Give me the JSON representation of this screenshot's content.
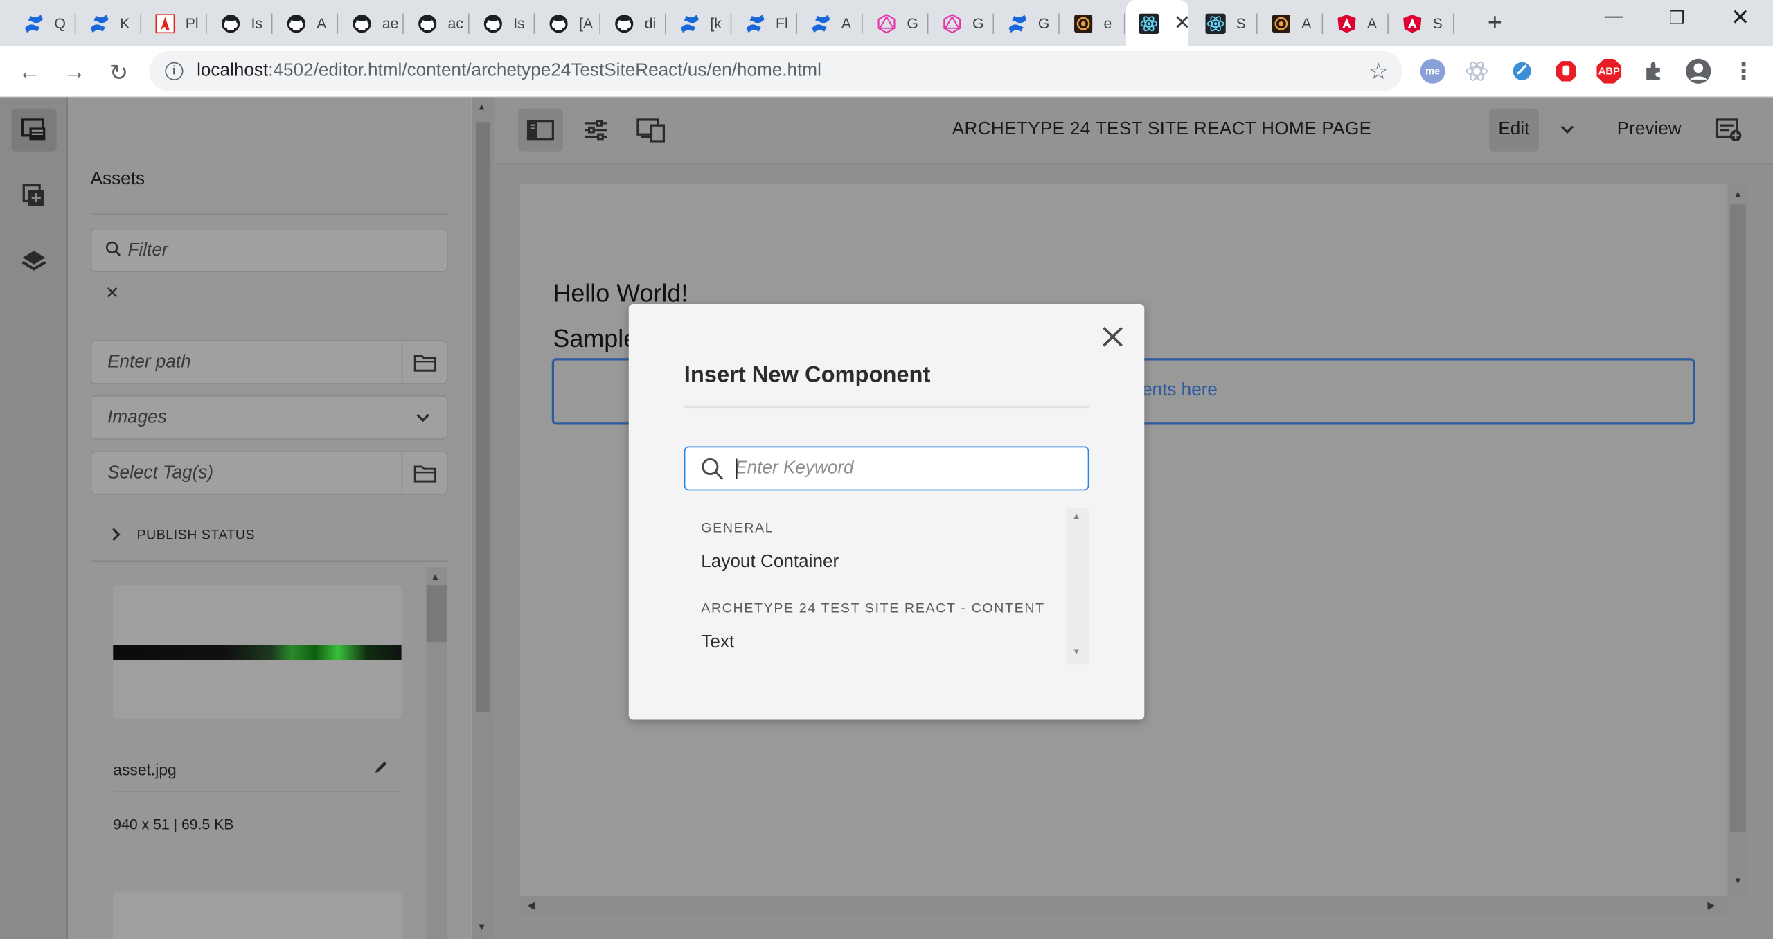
{
  "browser": {
    "tabs": [
      {
        "icon": "confluence-icon",
        "label": "Q"
      },
      {
        "icon": "confluence-icon",
        "label": "K"
      },
      {
        "icon": "adobe-icon",
        "label": "Pl"
      },
      {
        "icon": "github-icon",
        "label": "Is"
      },
      {
        "icon": "github-icon",
        "label": "A"
      },
      {
        "icon": "github-icon",
        "label": "ae"
      },
      {
        "icon": "github-icon",
        "label": "ac"
      },
      {
        "icon": "github-icon",
        "label": "Is"
      },
      {
        "icon": "github-icon",
        "label": "[A"
      },
      {
        "icon": "github-icon",
        "label": "di"
      },
      {
        "icon": "confluence-icon",
        "label": "[k"
      },
      {
        "icon": "confluence-icon",
        "label": "Fl"
      },
      {
        "icon": "confluence-icon",
        "label": "A"
      },
      {
        "icon": "graphql-icon",
        "label": "G"
      },
      {
        "icon": "graphql-icon",
        "label": "G"
      },
      {
        "icon": "confluence-icon",
        "label": "G"
      },
      {
        "icon": "aem-icon",
        "label": "e"
      },
      {
        "icon": "react-icon",
        "label": "",
        "active": true
      },
      {
        "icon": "react-icon",
        "label": "S"
      },
      {
        "icon": "aem-icon",
        "label": "A"
      },
      {
        "icon": "angular-icon",
        "label": "A"
      },
      {
        "icon": "angular-icon",
        "label": "S"
      }
    ],
    "new_tab": "+",
    "url_host": "localhost",
    "url_path": ":4502/editor.html/content/archetype24TestSiteReact/us/en/home.html",
    "extensions": {
      "me": "me",
      "abp": "ABP"
    }
  },
  "assets_panel": {
    "title": "Assets",
    "filter_placeholder": "Filter",
    "clear_symbol": "✕",
    "path_placeholder": "Enter path",
    "type_select": "Images",
    "tags_placeholder": "Select Tag(s)",
    "publish_status": "PUBLISH STATUS",
    "asset_name": "asset.jpg",
    "asset_meta": "940 x 51 | 69.5 KB"
  },
  "editor": {
    "page_title": "ARCHETYPE 24 TEST SITE REACT HOME PAGE",
    "edit_label": "Edit",
    "preview_label": "Preview",
    "hello": "Hello World!",
    "sample": "Sample",
    "dropzone_text": "ents here"
  },
  "dialog": {
    "title": "Insert New Component",
    "search_placeholder": "Enter Keyword",
    "groups": [
      {
        "name": "GENERAL",
        "items": [
          "Layout Container"
        ]
      },
      {
        "name": "ARCHETYPE 24 TEST SITE REACT - CONTENT",
        "items": [
          "Text"
        ]
      }
    ]
  },
  "colors": {
    "accent": "#2680eb",
    "dropzone_border": "#2d5c9e",
    "abp_red": "#e81d25"
  }
}
